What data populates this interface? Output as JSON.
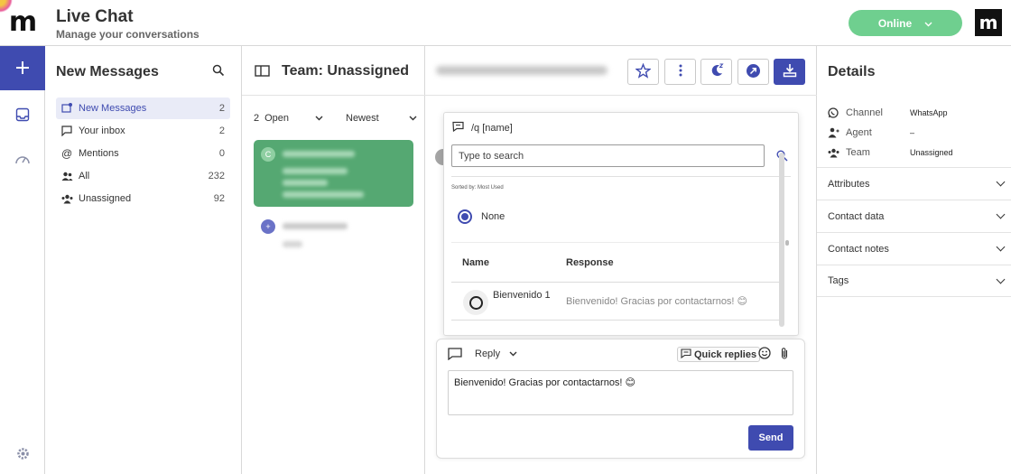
{
  "app": {
    "title": "Live Chat",
    "subtitle": "Manage your conversations",
    "logo_letter": "m",
    "brand_letter": "m"
  },
  "status": {
    "label": "Online",
    "color": "#6fcf8f"
  },
  "accent_color": "#3f4bb0",
  "rail": {
    "add_icon": "plus-icon",
    "items": [
      "inbox-icon",
      "dashboard-icon"
    ],
    "settings_icon": "gear-icon"
  },
  "inbox_panel": {
    "title": "New Messages",
    "items": [
      {
        "label": "New Messages",
        "count": "2",
        "icon": "new-message-icon",
        "active": true
      },
      {
        "label": "Your inbox",
        "count": "2",
        "icon": "chat-bubble-icon"
      },
      {
        "label": "Mentions",
        "count": "0",
        "icon": "at-icon"
      },
      {
        "label": "All",
        "count": "232",
        "icon": "people-icon"
      },
      {
        "label": "Unassigned",
        "count": "92",
        "icon": "unassigned-icon"
      }
    ]
  },
  "conversations": {
    "title": "Team: Unassigned",
    "filter_count": "2",
    "filter_status": "Open",
    "sort": "Newest",
    "cards": [
      {
        "avatar_letter": "C",
        "selected": true
      },
      {
        "avatar_letter": "+",
        "selected": false
      }
    ]
  },
  "chat": {
    "header_buttons": [
      "star-icon",
      "more-vertical-icon",
      "snooze-icon",
      "forward-icon",
      "download-icon"
    ],
    "quick_reply_popup": {
      "command": "/q [name]",
      "search_placeholder": "Type to search",
      "sorted_by": "Sorted by: Most Used",
      "none_option": "None",
      "columns": {
        "name": "Name",
        "response": "Response"
      },
      "rows": [
        {
          "name": "Bienvenido 1",
          "response": "Bienvenido! Gracias por contactarnos! 😊"
        }
      ]
    },
    "composer": {
      "mode": "Reply",
      "quick_replies_label": "Quick replies",
      "message": "Bienvenido! Gracias por contactarnos! 😊",
      "send_label": "Send"
    }
  },
  "details": {
    "title": "Details",
    "fields": [
      {
        "label": "Channel",
        "value": "WhatsApp",
        "icon": "whatsapp-icon"
      },
      {
        "label": "Agent",
        "value": "–",
        "icon": "agent-icon"
      },
      {
        "label": "Team",
        "value": "Unassigned",
        "icon": "team-icon"
      }
    ],
    "sections": [
      "Attributes",
      "Contact data",
      "Contact notes",
      "Tags"
    ]
  }
}
